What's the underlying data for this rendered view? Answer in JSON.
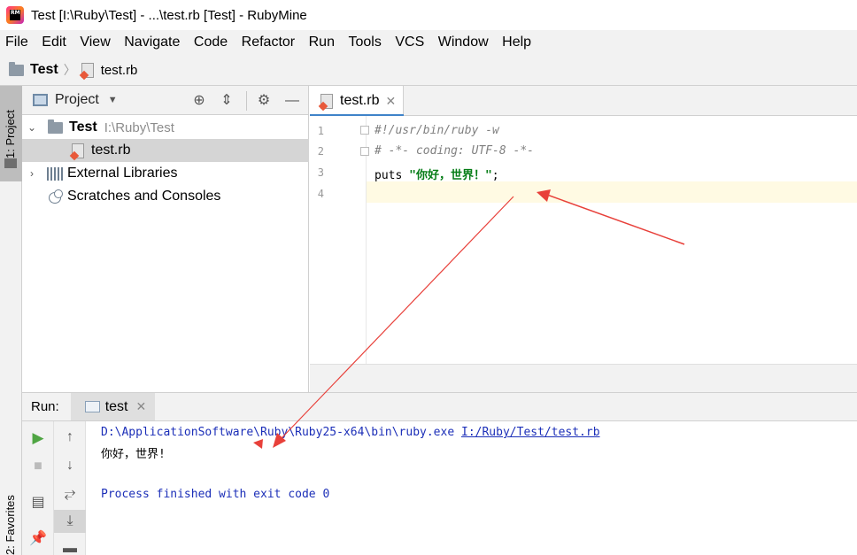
{
  "window": {
    "title": "Test [I:\\Ruby\\Test] - ...\\test.rb [Test] - RubyMine",
    "logo_text": "RM"
  },
  "menu": [
    "File",
    "Edit",
    "View",
    "Navigate",
    "Code",
    "Refactor",
    "Run",
    "Tools",
    "VCS",
    "Window",
    "Help"
  ],
  "breadcrumb": {
    "project": "Test",
    "file": "test.rb"
  },
  "side_strip": {
    "project_label": "1: Project",
    "favorites_label": "2: Favorites"
  },
  "project_panel": {
    "title": "Project",
    "tree": {
      "root_name": "Test",
      "root_path": "I:\\Ruby\\Test",
      "file": "test.rb",
      "external_libraries": "External Libraries",
      "scratches": "Scratches and Consoles"
    }
  },
  "editor": {
    "tab_label": "test.rb",
    "line_numbers": [
      "1",
      "2",
      "3",
      "4"
    ],
    "lines": {
      "l1": "#!/usr/bin/ruby -w",
      "l2": "# -*- coding: UTF-8 -*-",
      "l3_keyword": "puts ",
      "l3_string": "\"你好，世界！\"",
      "l3_end": ";"
    }
  },
  "run": {
    "label": "Run:",
    "tab": "test",
    "console": {
      "cmd": "D:\\ApplicationSoftware\\Ruby\\Ruby25-x64\\bin\\ruby.exe ",
      "script_link": "I:/Ruby/Test/test.rb",
      "output": "你好，世界!",
      "exit": "Process finished with exit code 0"
    }
  },
  "colors": {
    "accent": "#4083c9",
    "annotation_arrow": "#e8403a",
    "run_green": "#4fa543"
  }
}
